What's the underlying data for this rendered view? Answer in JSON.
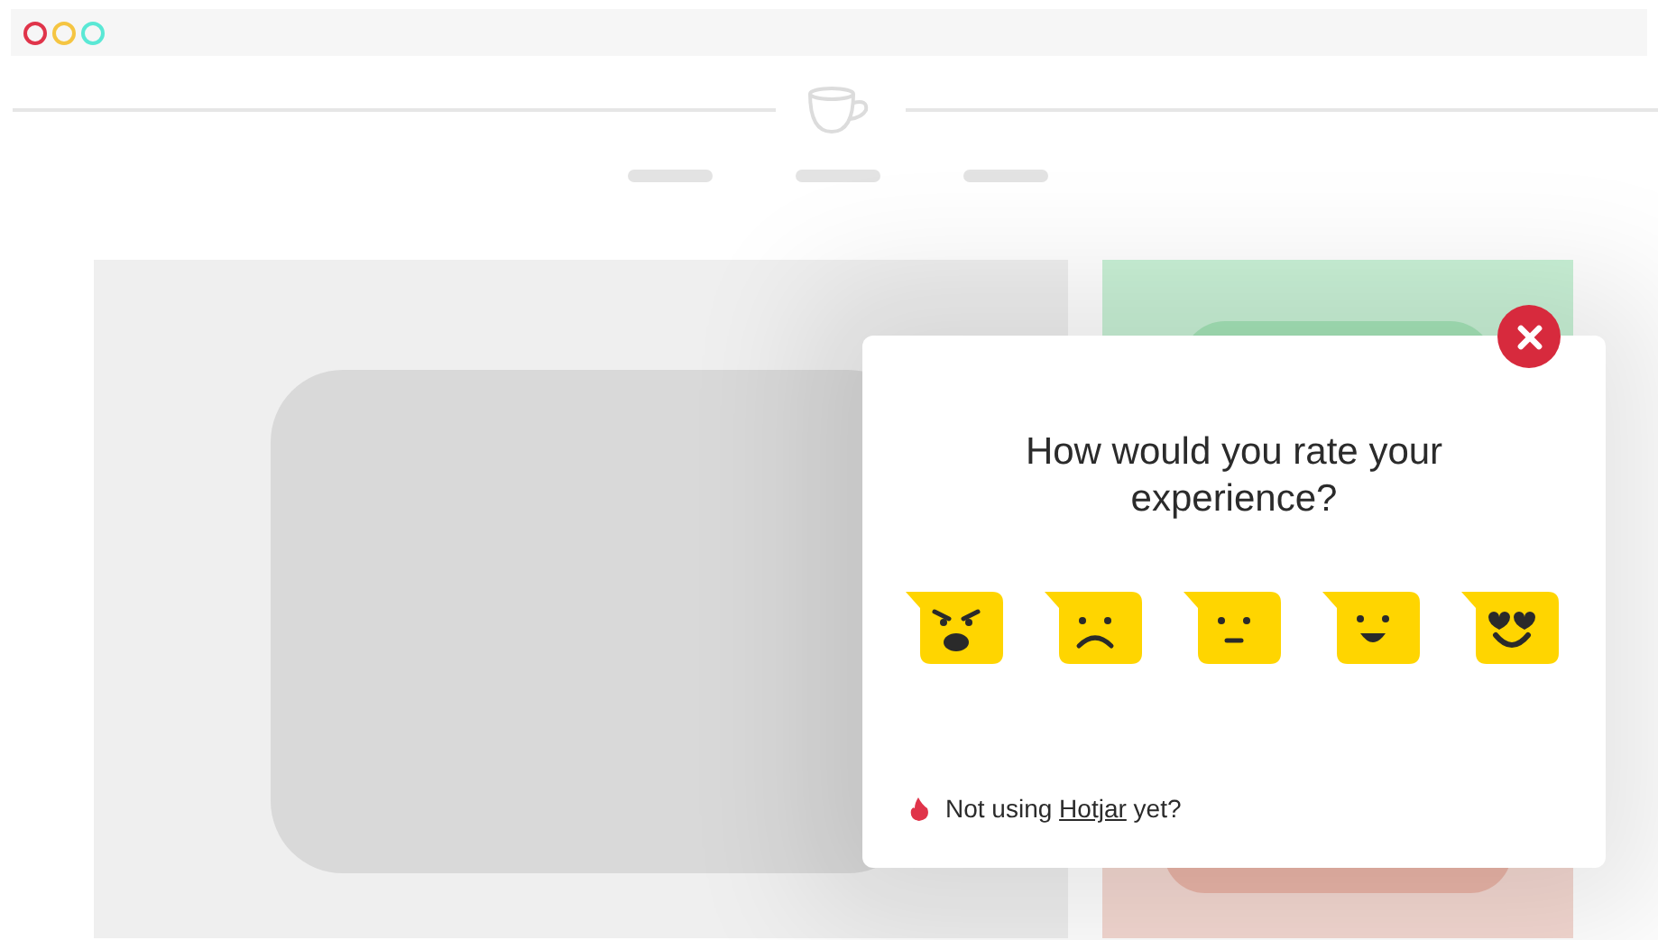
{
  "window": {
    "controls": [
      {
        "color": "#e0344a"
      },
      {
        "color": "#f5c542"
      },
      {
        "color": "#5ae8d5"
      }
    ]
  },
  "popup": {
    "question": "How would you rate your experience?",
    "ratings": [
      {
        "kind": "angry"
      },
      {
        "kind": "sad"
      },
      {
        "kind": "neutral"
      },
      {
        "kind": "happy"
      },
      {
        "kind": "love"
      }
    ],
    "footer": {
      "before": "Not using",
      "link": "Hotjar",
      "after": "yet?"
    }
  }
}
